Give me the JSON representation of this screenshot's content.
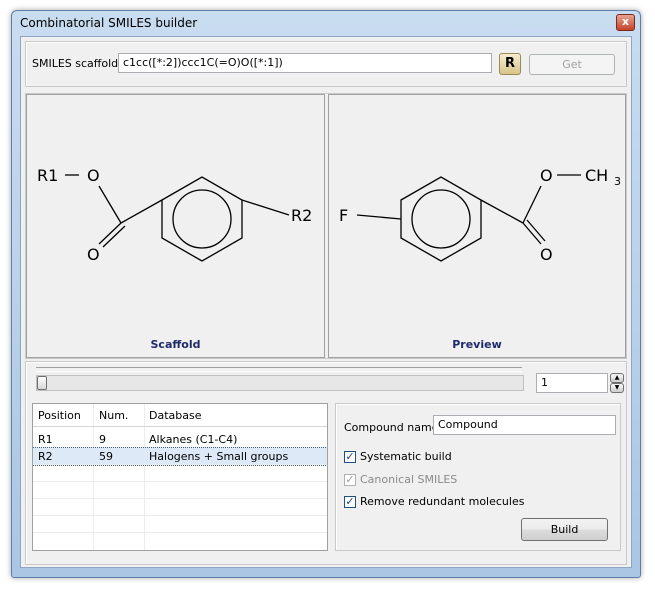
{
  "window": {
    "title": "Combinatorial SMILES builder",
    "close_glyph": "x"
  },
  "scaffold_bar": {
    "label": "SMILES scaffold:",
    "value": "c1cc([*:2])ccc1C(=O)O([*:1])",
    "r_button_label": "R",
    "get_button_label": "Get"
  },
  "scaffold_panel": {
    "caption": "Scaffold",
    "atoms": {
      "r1": "R1",
      "o_top": "O",
      "o_bottom": "O",
      "r2": "R2"
    }
  },
  "preview_panel": {
    "caption": "Preview",
    "atoms": {
      "f": "F",
      "o_top": "O",
      "ch": "CH",
      "sub3": "3",
      "o_bottom": "O"
    }
  },
  "slider": {
    "value": "1",
    "fraction": 0.0
  },
  "position_table": {
    "columns": [
      "Position",
      "Num.",
      "Database"
    ],
    "rows": [
      {
        "position": "R1",
        "num": "9",
        "database": "Alkanes (C1-C4)",
        "selected": false
      },
      {
        "position": "R2",
        "num": "59",
        "database": "Halogens + Small groups",
        "selected": true
      }
    ]
  },
  "options": {
    "compound_name_label": "Compound name:",
    "compound_name_value": "Compound",
    "systematic_build": {
      "label": "Systematic build",
      "checked": true,
      "enabled": true
    },
    "canonical_smiles": {
      "label": "Canonical SMILES",
      "checked": true,
      "enabled": false
    },
    "remove_redundant": {
      "label": "Remove redundant molecules",
      "checked": true,
      "enabled": true
    },
    "build_button_label": "Build"
  },
  "colors": {
    "caption": "#1f2a6b",
    "selection": "#dde9f7"
  }
}
